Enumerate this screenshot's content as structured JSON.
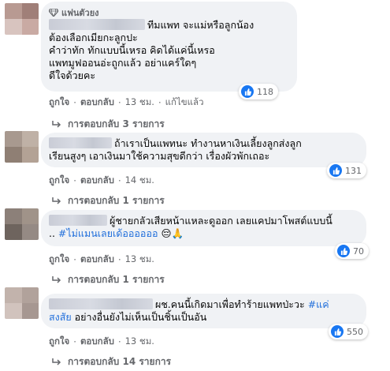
{
  "colors": {
    "bubble": "#f0f2f5",
    "secondary_text": "#65676b",
    "like_blue": "#1877f2",
    "hashtag": "#216fdb"
  },
  "comments": [
    {
      "badge": "แฟนตัวยง",
      "lines": [
        "ทีมแพท จะแม่หรือลูกน้อง",
        "ต้องเลือกเมียกะลูกปะ",
        "คำว่าทัก ทักแบบนี้เหรอ คิดได้แค่นี้เหรอ",
        "แพทมูฟออนอ่ะถูกแล้ว อย่าแคร์ใดๆ",
        "ดีใจด้วยคะ"
      ],
      "like_count": "118",
      "actions": {
        "like": "ถูกใจ",
        "reply": "ตอบกลับ",
        "time": "13 ชม.",
        "edited": "แก้ไขแล้ว"
      },
      "replies_label": "การตอบกลับ 3 รายการ"
    },
    {
      "lines": [
        "ถ้าเราเป็นแพทนะ ทำงานหาเงินเลี้ยงลูกส่งลูก",
        "เรียนสูงๆ เอาเงินมาใช้ความสุขดีกว่า เรื่องผัวพักเถอะ"
      ],
      "like_count": "131",
      "actions": {
        "like": "ถูกใจ",
        "reply": "ตอบกลับ",
        "time": "14 ชม."
      },
      "replies_label": "การตอบกลับ 1 รายการ"
    },
    {
      "lines": [
        "ผู้ชายกลัวเสียหน้าแหละดูออก เลยแคปมาโพสต์แบบนี้",
        ".. ",
        "#ไม่แมนเลยเด้ออออออ",
        " 😔🙏"
      ],
      "like_count": "70",
      "actions": {
        "like": "ถูกใจ",
        "reply": "ตอบกลับ",
        "time": "13 ชม."
      },
      "replies_label": "การตอบกลับ 1 รายการ"
    },
    {
      "lines": [
        "ผช.คนนี้เกิดมาเพื่อทำร้ายแพทป่ะวะ ",
        "#แค่",
        "สงสัย",
        " อย่างอื่นยังไม่เห็นเป็นชิ้นเป็นอัน"
      ],
      "like_count": "550",
      "actions": {
        "like": "ถูกใจ",
        "reply": "ตอบกลับ",
        "time": "13 ชม."
      },
      "replies_label": "การตอบกลับ 14 รายการ"
    }
  ]
}
